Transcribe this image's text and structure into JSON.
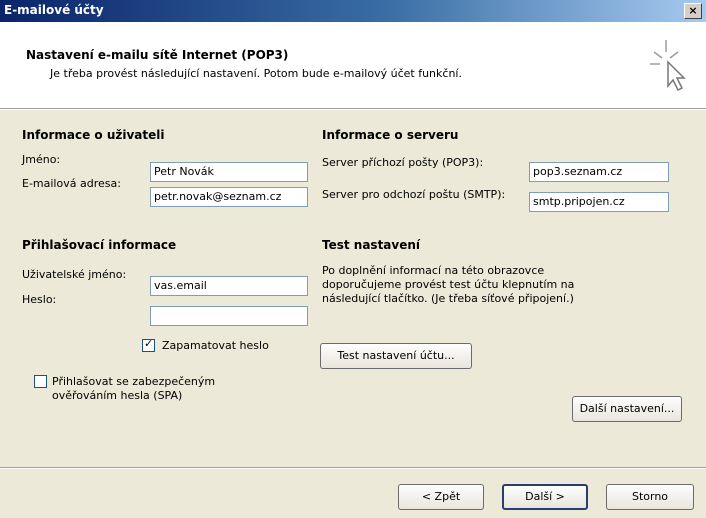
{
  "window": {
    "title": "E-mailové účty",
    "close_label": "×"
  },
  "header": {
    "title": "Nastavení e-mailu sítě Internet (POP3)",
    "subtitle": "Je třeba provést následující nastavení. Potom bude e-mailový účet funkční."
  },
  "user_info": {
    "title": "Informace o uživateli",
    "name_label": "Jméno:",
    "name_value": "Petr Novák",
    "email_label": "E-mailová adresa:",
    "email_value": "petr.novak@seznam.cz"
  },
  "server_info": {
    "title": "Informace o serveru",
    "incoming_label": "Server příchozí pošty (POP3):",
    "incoming_value": "pop3.seznam.cz",
    "outgoing_label": "Server pro odchozí poštu (SMTP):",
    "outgoing_value": "smtp.pripojen.cz"
  },
  "login_info": {
    "title": "Přihlašovací informace",
    "username_label": "Uživatelské jméno:",
    "username_value": "vas.email",
    "password_label": "Heslo:",
    "password_value": "",
    "remember_label": "Zapamatovat heslo",
    "remember_checked": true,
    "spa_label_line1": "Přihlašovat se zabezpečeným",
    "spa_label_line2": "ověřováním hesla (SPA)",
    "spa_checked": false
  },
  "test": {
    "title": "Test nastavení",
    "line1": "Po doplnění informací na této obrazovce",
    "line2": "doporučujeme provést test účtu klepnutím na",
    "line3": "následující tlačítko. (Je třeba síťové připojení.)",
    "button": "Test nastavení účtu..."
  },
  "more_settings_button": "Další nastavení...",
  "footer": {
    "back": "< Zpět",
    "next": "Další >",
    "cancel": "Storno"
  }
}
